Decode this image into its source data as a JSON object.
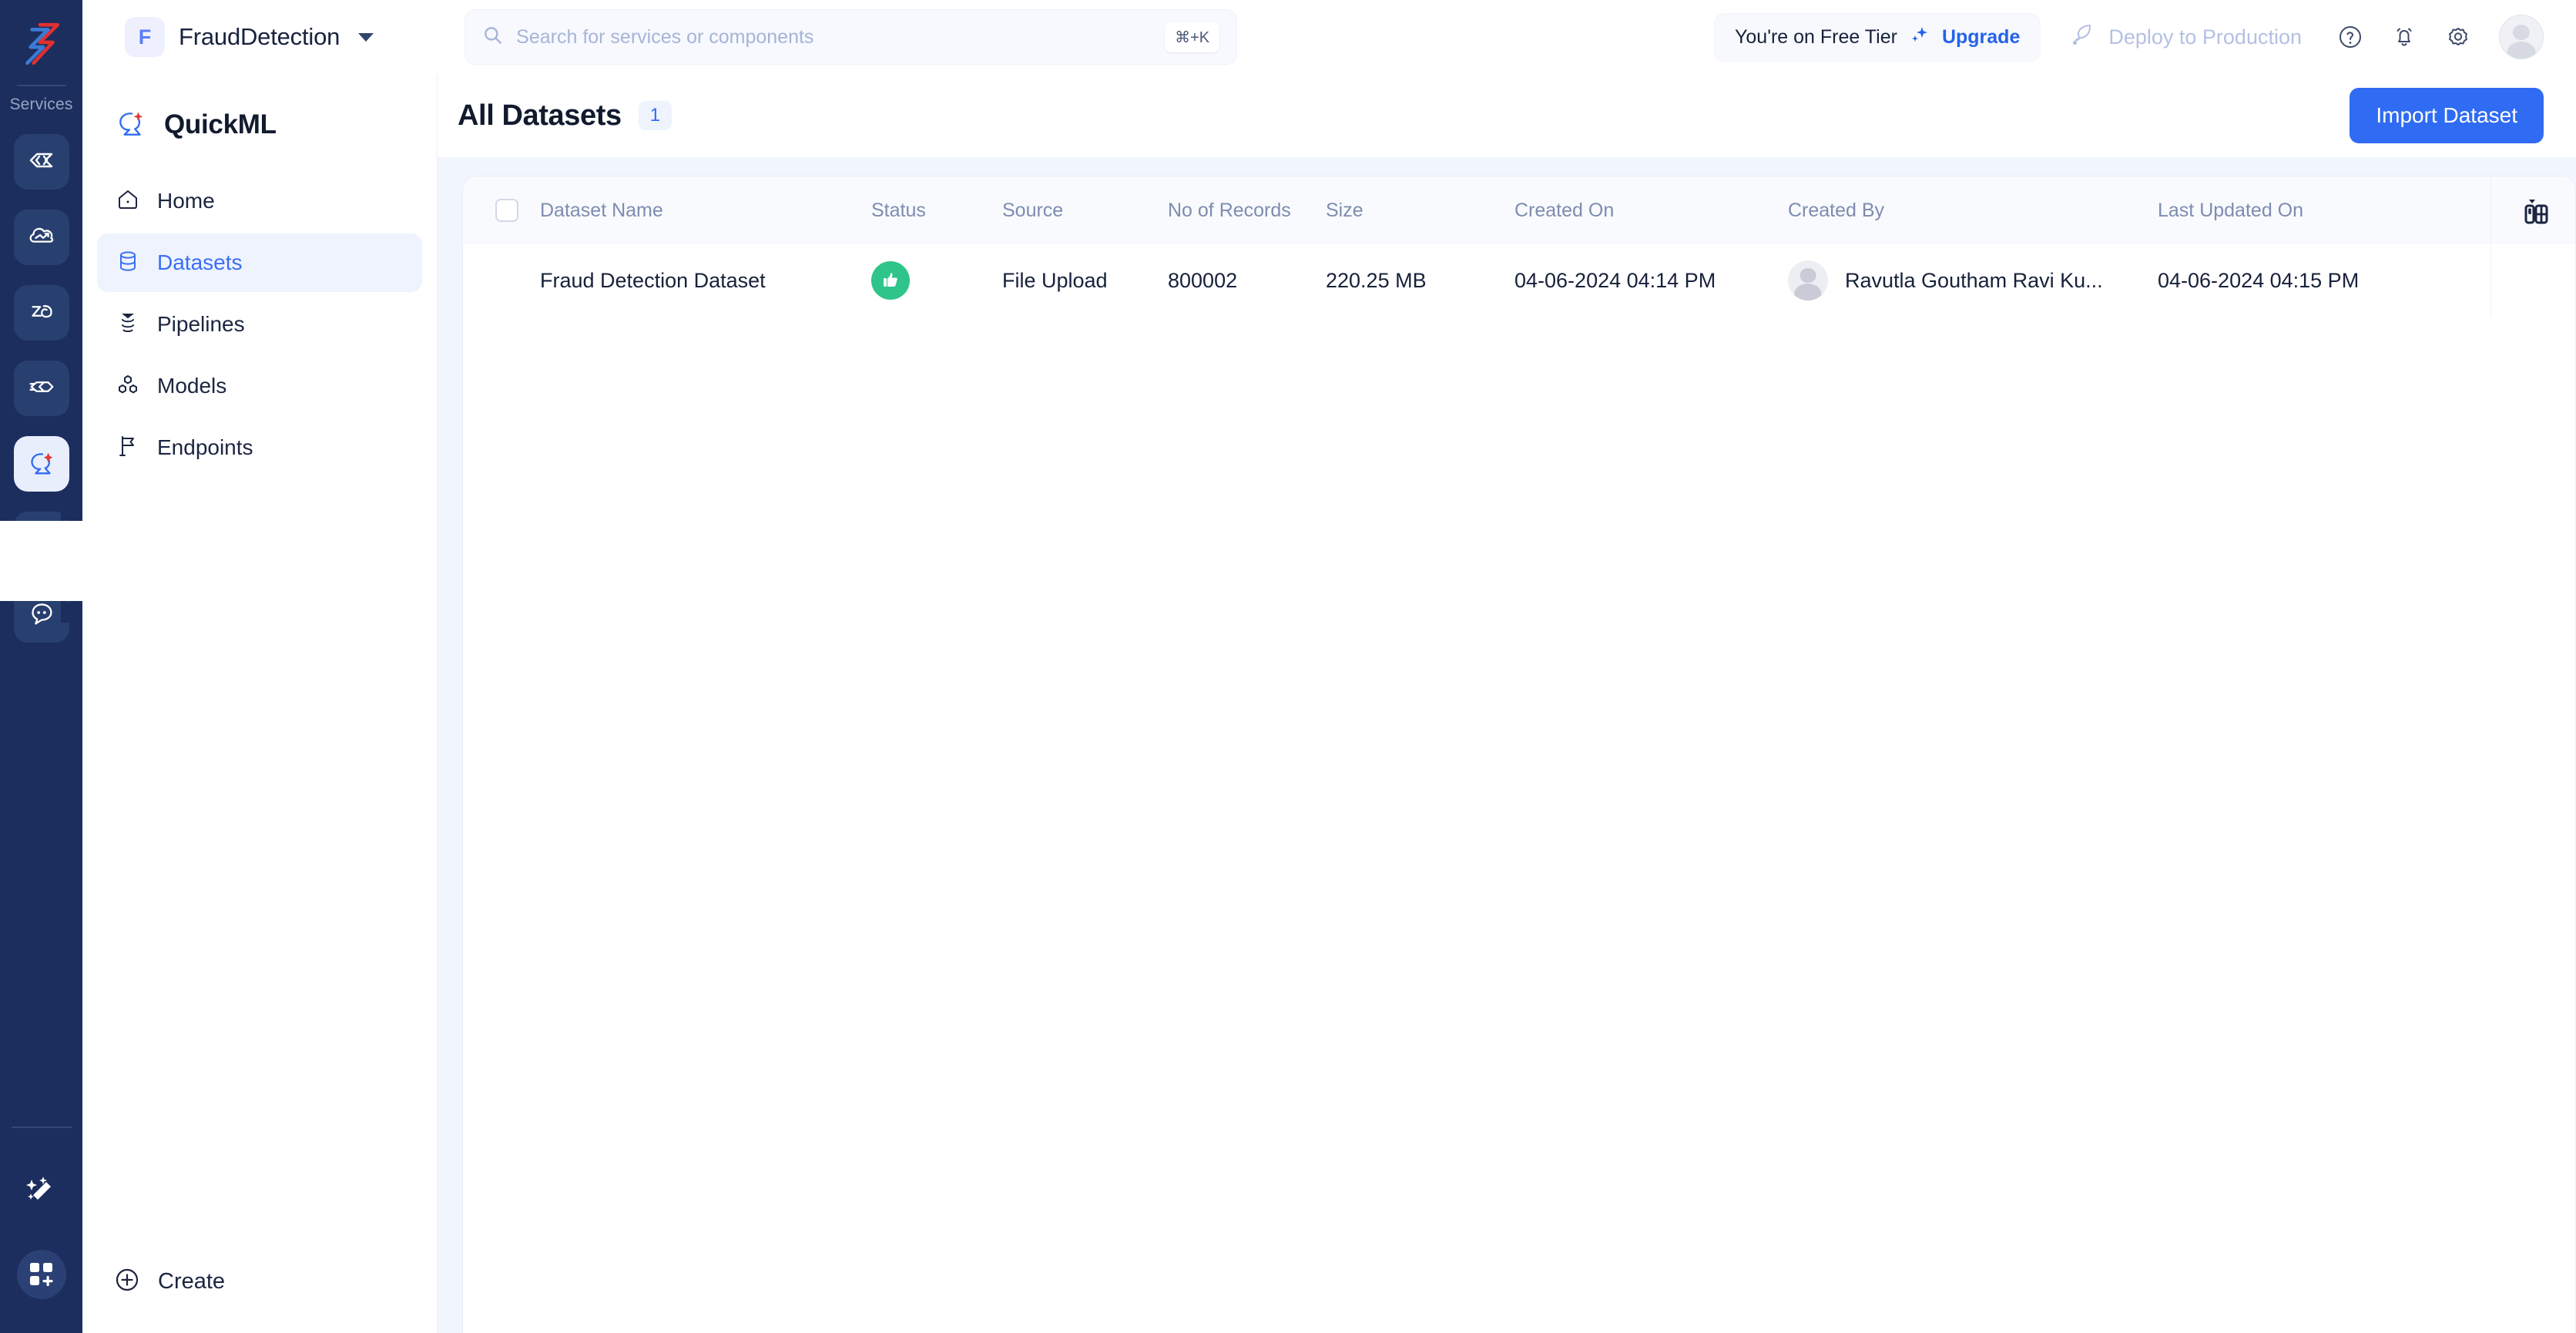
{
  "rail": {
    "services_label": "Services",
    "items": [
      {
        "name": "code-service-icon"
      },
      {
        "name": "cloud-deploy-icon"
      },
      {
        "name": "data-flow-icon"
      },
      {
        "name": "integration-icon"
      },
      {
        "name": "quickml-icon",
        "active": true
      },
      {
        "name": "orbit-icon"
      },
      {
        "name": "chat-bot-icon"
      }
    ],
    "magic_icon": "magic-wand-icon",
    "apps_icon": "apps-grid-add-icon"
  },
  "topbar": {
    "project_initial": "F",
    "project_name": "FraudDetection",
    "search_placeholder": "Search for services or components",
    "search_value": "",
    "search_shortcut": "⌘+K",
    "tier_text": "You're on Free Tier",
    "upgrade_label": "Upgrade",
    "deploy_label": "Deploy to Production",
    "icons": [
      "help-icon",
      "bell-icon",
      "gear-icon",
      "avatar"
    ]
  },
  "sidebar": {
    "brand": "QuickML",
    "items": [
      {
        "label": "Home",
        "icon": "home-icon",
        "active": false
      },
      {
        "label": "Datasets",
        "icon": "database-icon",
        "active": true
      },
      {
        "label": "Pipelines",
        "icon": "pipelines-icon",
        "active": false
      },
      {
        "label": "Models",
        "icon": "models-icon",
        "active": false
      },
      {
        "label": "Endpoints",
        "icon": "flag-icon",
        "active": false
      }
    ],
    "create_label": "Create"
  },
  "main": {
    "title": "All Datasets",
    "count": "1",
    "import_label": "Import Dataset",
    "table": {
      "columns": [
        "Dataset Name",
        "Status",
        "Source",
        "No of Records",
        "Size",
        "Created On",
        "Created By",
        "Last Updated On"
      ],
      "rows": [
        {
          "name": "Fraud Detection Dataset",
          "status": "thumbs-up",
          "source": "File Upload",
          "records": "800002",
          "size": "220.25 MB",
          "created_on": "04-06-2024 04:14 PM",
          "created_by": "Ravutla Goutham Ravi Ku...",
          "last_updated_on": "04-06-2024 04:15 PM"
        }
      ]
    }
  },
  "colors": {
    "accent": "#2f6bf3",
    "rail_bg": "#1c2e5e",
    "status_green": "#2fc58a",
    "panel_bg": "#f1f5fd",
    "muted_text": "#7e8cb0"
  }
}
